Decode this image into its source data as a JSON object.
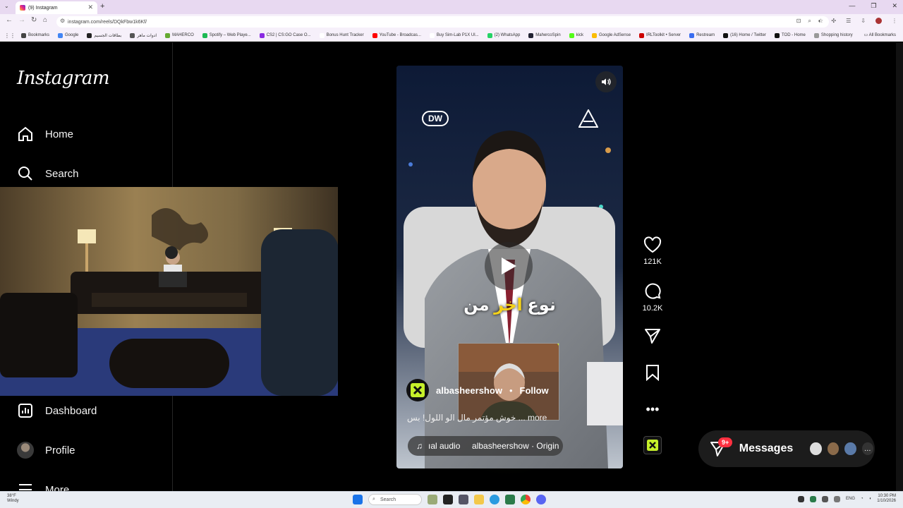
{
  "browser": {
    "tab_title": "(9) Instagram",
    "url": "instagram.com/reels/DQkFbw1k6Kf/",
    "bookmarks": [
      {
        "label": "Bookmarks",
        "color": "#444"
      },
      {
        "label": "Google",
        "color": "#4285f4"
      },
      {
        "label": "بطاقات الجسيم",
        "color": "#222"
      },
      {
        "label": "ادوات ماهر",
        "color": "#555"
      },
      {
        "label": "MAHERCO",
        "color": "#6a3"
      },
      {
        "label": "Spotify – Web Playe...",
        "color": "#1db954"
      },
      {
        "label": "CS2 | CS:GO Case O...",
        "color": "#8a2be2"
      },
      {
        "label": "Bonus Hunt Tracker",
        "color": "#fff"
      },
      {
        "label": "YouTube - Broadcas...",
        "color": "#ff0000"
      },
      {
        "label": "Buy Sim-Lab P1X Ul...",
        "color": "#fff"
      },
      {
        "label": "(2) WhatsApp",
        "color": "#25d366"
      },
      {
        "label": "MahercoSpin",
        "color": "#223"
      },
      {
        "label": "kick",
        "color": "#53fc18"
      },
      {
        "label": "Google AdSense",
        "color": "#fbbc04"
      },
      {
        "label": "IRLToolkit • Server",
        "color": "#c00"
      },
      {
        "label": "Restream",
        "color": "#3a6df0"
      },
      {
        "label": "(16) Home / Twitter",
        "color": "#111"
      },
      {
        "label": "TOD - Home",
        "color": "#111"
      },
      {
        "label": "Shopping history",
        "color": "#999"
      }
    ],
    "all_bookmarks": "All Bookmarks"
  },
  "sidebar": {
    "logo": "Instagram",
    "items": [
      {
        "label": "Home",
        "icon": "home-icon"
      },
      {
        "label": "Search",
        "icon": "search-icon"
      },
      {
        "label": "Dashboard",
        "icon": "dashboard-icon"
      },
      {
        "label": "Profile",
        "icon": "avatar"
      },
      {
        "label": "More",
        "icon": "menu-icon"
      }
    ]
  },
  "reel": {
    "brand_left": "DW",
    "subtitle_pre": "نوع ",
    "subtitle_highlight": "اخر",
    "subtitle_post": " من",
    "account": "albasheershow",
    "dot": "•",
    "follow": "Follow",
    "caption": "خوش مؤتمر مال الو اللول! بس ... more",
    "audio": "ıal audio     albasheershow · Origin"
  },
  "actions": {
    "likes": "121K",
    "comments": "10.2K"
  },
  "messages": {
    "label": "Messages",
    "badge": "9+"
  },
  "taskbar": {
    "temp": "38°F",
    "weather": "Windy",
    "search": "Search",
    "lang": "ENG",
    "time": "10:30 PM",
    "date": "1/10/2026"
  },
  "colors": {
    "accent": "#0095f6",
    "badge": "#ff3040",
    "subtitle_highlight": "#f5d21a"
  }
}
